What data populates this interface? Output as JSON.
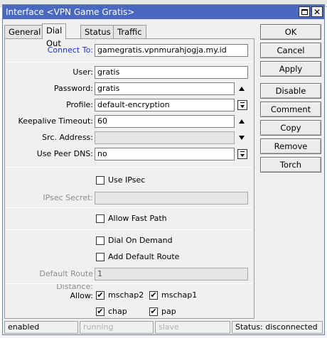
{
  "window": {
    "title": "Interface <VPN Game Gratis>",
    "close_glyph": "✕"
  },
  "tabs": [
    "General",
    "Dial Out",
    "Status",
    "Traffic"
  ],
  "active_tab": "Dial Out",
  "form": {
    "connect_to": {
      "label": "Connect To:",
      "value": "gamegratis.vpnmurahjogja.my.id"
    },
    "user": {
      "label": "User:",
      "value": "gratis"
    },
    "password": {
      "label": "Password:",
      "value": "gratis"
    },
    "profile": {
      "label": "Profile:",
      "value": "default-encryption"
    },
    "keepalive_timeout": {
      "label": "Keepalive Timeout:",
      "value": "60"
    },
    "src_address": {
      "label": "Src. Address:",
      "value": ""
    },
    "use_peer_dns": {
      "label": "Use Peer DNS:",
      "value": "no"
    },
    "use_ipsec": {
      "label": "Use IPsec",
      "checked": false
    },
    "ipsec_secret": {
      "label": "IPsec Secret:",
      "value": ""
    },
    "allow_fast_path": {
      "label": "Allow Fast Path",
      "checked": false
    },
    "dial_on_demand": {
      "label": "Dial On Demand",
      "checked": false
    },
    "add_default_route": {
      "label": "Add Default Route",
      "checked": false
    },
    "default_route_distance": {
      "label": "Default Route Distance:",
      "value": "1"
    },
    "allow": {
      "label": "Allow:",
      "options": [
        {
          "label": "mschap2",
          "checked": true
        },
        {
          "label": "mschap1",
          "checked": true
        },
        {
          "label": "chap",
          "checked": true
        },
        {
          "label": "pap",
          "checked": true
        }
      ]
    }
  },
  "buttons": {
    "ok": "OK",
    "cancel": "Cancel",
    "apply": "Apply",
    "disable": "Disable",
    "comment": "Comment",
    "copy": "Copy",
    "remove": "Remove",
    "torch": "Torch"
  },
  "status_bar": {
    "state": "enabled",
    "running": "running",
    "slave": "slave",
    "status": "Status: disconnected"
  },
  "check_glyph": "✔",
  "colors": {
    "titlebar": "#4a68c0",
    "link_label": "#1a33c8"
  }
}
